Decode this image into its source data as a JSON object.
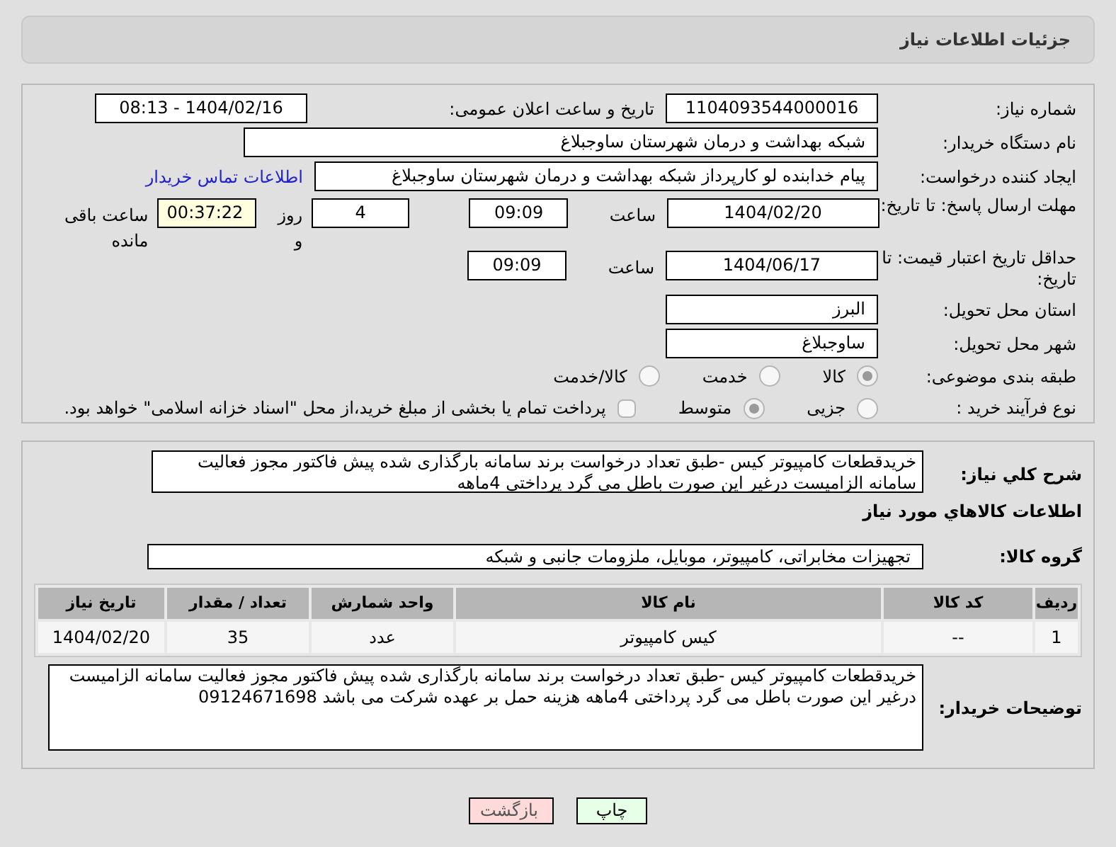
{
  "header": {
    "title": "جزئیات اطلاعات نیاز"
  },
  "fields": {
    "need_number": {
      "label": "شماره نیاز:",
      "value": "1104093544000016"
    },
    "announce": {
      "label": "تاریخ و ساعت اعلان عمومی:",
      "value": "1404/02/16 - 08:13"
    },
    "buyer": {
      "label": "نام دستگاه خریدار:",
      "value": "شبکه بهداشت و درمان شهرستان ساوجبلاغ"
    },
    "creator": {
      "label": "ایجاد کننده درخواست:",
      "value": "پیام خدابنده لو کارپرداز شبکه بهداشت و درمان شهرستان ساوجبلاغ",
      "link": "اطلاعات تماس خریدار"
    },
    "deadline": {
      "label": "مهلت ارسال پاسخ: تا تاریخ:",
      "date": "1404/02/20",
      "time_label": "ساعت",
      "time": "09:09",
      "days": "4",
      "days_label": "روز و",
      "remaining": "00:37:22",
      "remaining_label": "ساعت باقی مانده"
    },
    "validity": {
      "label": "حداقل تاریخ اعتبار قیمت: تا تاریخ:",
      "date": "1404/06/17",
      "time_label": "ساعت",
      "time": "09:09"
    },
    "province": {
      "label": "استان محل تحویل:",
      "value": "البرز"
    },
    "city": {
      "label": "شهر محل تحویل:",
      "value": "ساوجبلاغ"
    },
    "category": {
      "label": "طبقه بندی موضوعی:",
      "options": [
        {
          "label": "کالا",
          "selected": true
        },
        {
          "label": "خدمت",
          "selected": false
        },
        {
          "label": "کالا/خدمت",
          "selected": false
        }
      ]
    },
    "process": {
      "label": "نوع فرآیند خرید :",
      "options": [
        {
          "label": "جزیی",
          "selected": false
        },
        {
          "label": "متوسط",
          "selected": true
        }
      ],
      "payment": {
        "label": "پرداخت تمام یا بخشی از مبلغ خرید،از محل \"اسناد خزانه اسلامی\" خواهد بود.",
        "checked": false
      }
    }
  },
  "description": {
    "label": "شرح كلي نياز:",
    "value": "خریدقطعات کامپیوتر کیس -طبق تعداد درخواست برند سامانه بارگذاری شده پیش فاکتور مجوز فعالیت سامانه الزامیست درغیر این صورت باطل می گرد پرداختی 4ماهه"
  },
  "goods": {
    "title": "اطلاعات كالاهاي مورد نياز",
    "group_label": "گروه كالا:",
    "group": "تجهیزات مخابراتی، کامپیوتر، موبایل، ملزومات جانبی و شبکه",
    "columns": [
      "ردیف",
      "کد کالا",
      "نام کالا",
      "واحد شمارش",
      "تعداد / مقدار",
      "تاریخ نیاز"
    ],
    "rows": [
      [
        "1",
        "--",
        "کیس کامپیوتر",
        "عدد",
        "35",
        "1404/02/20"
      ]
    ],
    "notes_label": "توضیحات خریدار:",
    "notes": "خریدقطعات کامپیوتر کیس -طبق تعداد درخواست برند سامانه بارگذاری شده پیش فاکتور مجوز فعالیت سامانه الزامیست درغیر این صورت باطل می گرد پرداختی 4ماهه هزینه حمل بر عهده شرکت می باشد 09124671698"
  },
  "buttons": {
    "print": "چاپ",
    "back": "بازگشت"
  }
}
